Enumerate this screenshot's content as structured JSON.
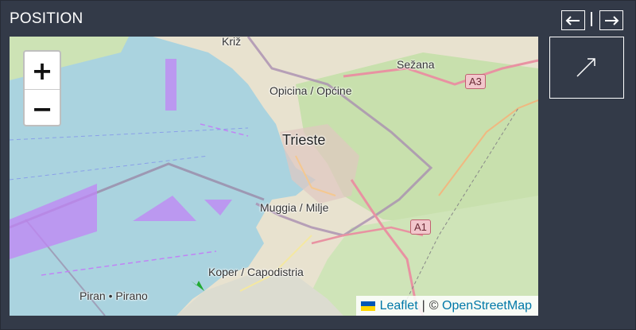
{
  "panel": {
    "title": "POSITION"
  },
  "nav": {
    "prev_icon": "arrow-left-icon",
    "next_icon": "arrow-right-icon"
  },
  "direction": {
    "icon": "arrow-up-right-icon"
  },
  "map": {
    "zoom_in": "+",
    "zoom_out": "−",
    "labels": {
      "kriz": "Križ",
      "sezana": "Sežana",
      "opicina": "Opicina / Općine",
      "trieste": "Trieste",
      "muggia": "Muggia / Milje",
      "koper": "Koper / Capodistria",
      "piran": "Piran • Pirano",
      "a3": "A3",
      "a1": "A1"
    },
    "attribution": {
      "leaflet": "Leaflet",
      "separator": "|",
      "copyright": "©",
      "osm": "OpenStreetMap"
    }
  }
}
